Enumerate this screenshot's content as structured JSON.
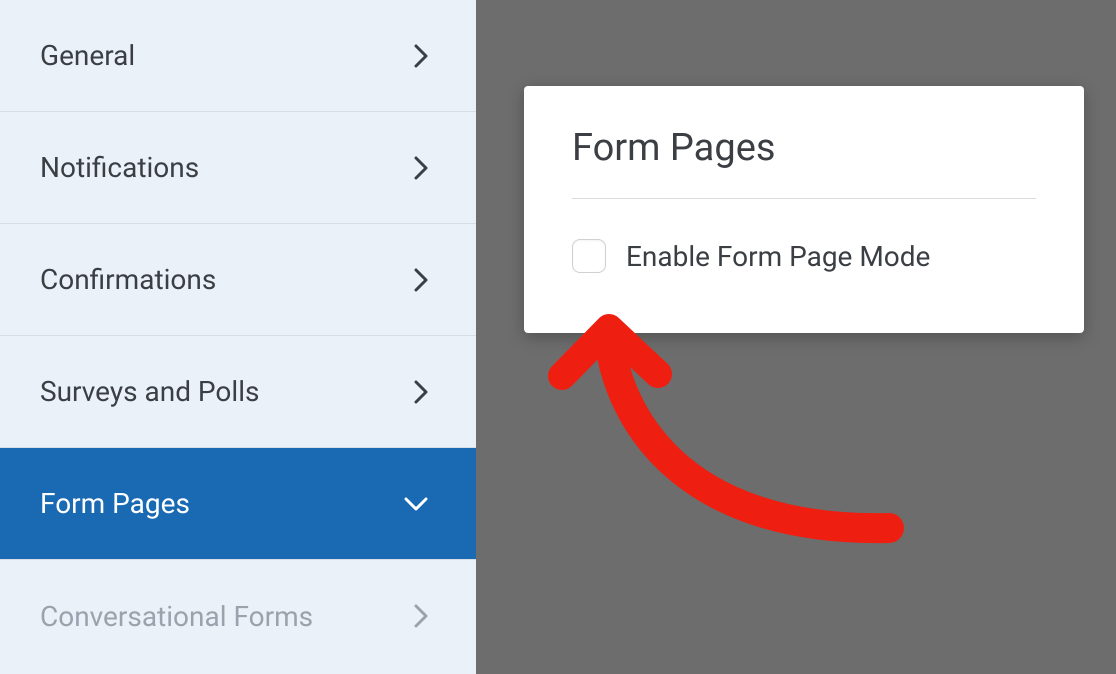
{
  "sidebar": {
    "items": [
      {
        "label": "General",
        "active": false,
        "disabled": false,
        "chevron": "right"
      },
      {
        "label": "Notifications",
        "active": false,
        "disabled": false,
        "chevron": "right"
      },
      {
        "label": "Confirmations",
        "active": false,
        "disabled": false,
        "chevron": "right"
      },
      {
        "label": "Surveys and Polls",
        "active": false,
        "disabled": false,
        "chevron": "right"
      },
      {
        "label": "Form Pages",
        "active": true,
        "disabled": false,
        "chevron": "down"
      },
      {
        "label": "Conversational Forms",
        "active": false,
        "disabled": true,
        "chevron": "right"
      }
    ]
  },
  "panel": {
    "title": "Form Pages",
    "checkbox_label": "Enable Form Page Mode",
    "checkbox_checked": false
  },
  "colors": {
    "sidebar_bg": "#eaf1f8",
    "active_bg": "#1a69b3",
    "content_bg": "#6d6d6d",
    "text": "#3b3f44",
    "disabled_text": "#9aa3ad",
    "annotation": "#ee1f11"
  }
}
